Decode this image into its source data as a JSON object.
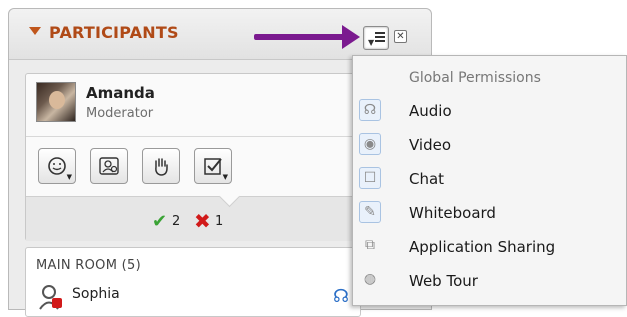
{
  "panel": {
    "title": "PARTICIPANTS"
  },
  "presenter": {
    "name": "Amanda",
    "role": "Moderator"
  },
  "toolbar": {
    "tools": [
      "emoticon",
      "profile",
      "raise-hand",
      "polling"
    ]
  },
  "poll_summary": {
    "yes_count": "2",
    "no_count": "1"
  },
  "room": {
    "title": "MAIN ROOM (5)",
    "first_participant": "Sophia"
  },
  "menu": {
    "header": "Global Permissions",
    "items": [
      {
        "label": "Audio",
        "icon": "audio-permission-icon"
      },
      {
        "label": "Video",
        "icon": "video-permission-icon"
      },
      {
        "label": "Chat",
        "icon": "chat-permission-icon"
      },
      {
        "label": "Whiteboard",
        "icon": "whiteboard-permission-icon"
      },
      {
        "label": "Application Sharing",
        "icon": "application-sharing-icon"
      },
      {
        "label": "Web Tour",
        "icon": "web-tour-icon"
      }
    ]
  },
  "colors": {
    "title": "#b04a17",
    "annotation_arrow": "#7b1a8f",
    "check": "#3aa335",
    "cross": "#d11a1a",
    "icon_highlight": "#a9c3e2"
  }
}
